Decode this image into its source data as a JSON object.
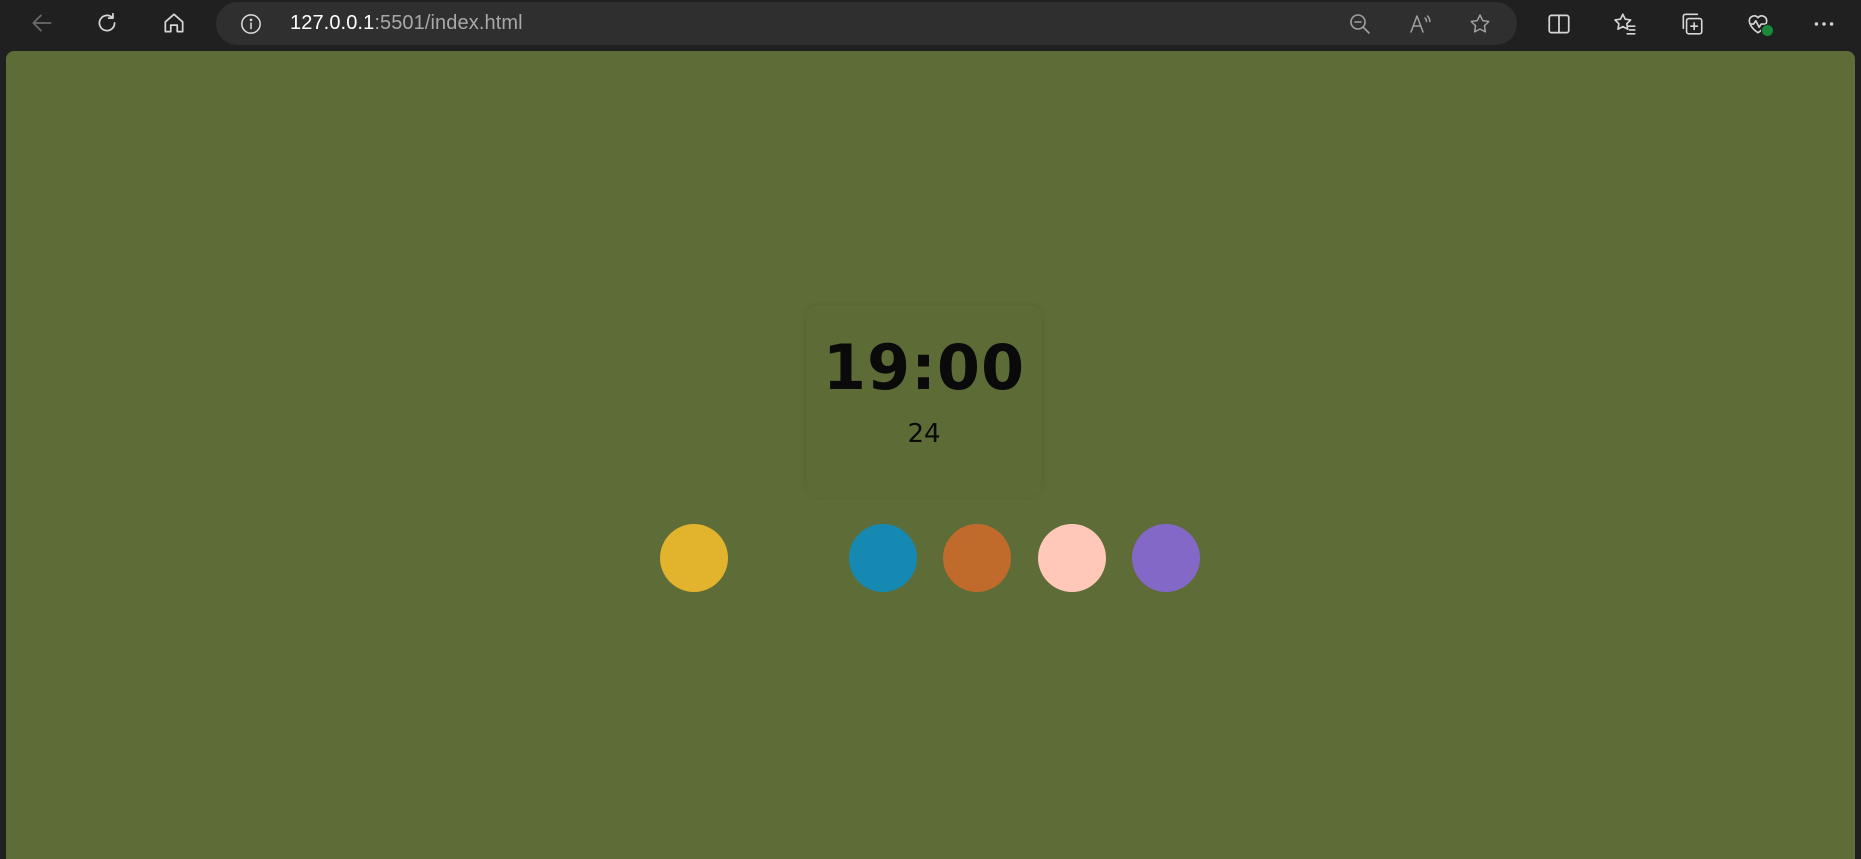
{
  "browser": {
    "url_host": "127.0.0.1",
    "url_rest": ":5501/index.html",
    "icons": [
      "back-arrow-icon",
      "refresh-icon",
      "home-icon",
      "info-icon",
      "zoom-out-icon",
      "read-aloud-icon",
      "favorite-star-icon",
      "split-screen-icon",
      "favorites-icon",
      "collections-icon",
      "browser-essentials-icon",
      "more-options-icon"
    ]
  },
  "clock": {
    "time": "19:00",
    "subtitle": "24"
  },
  "swatches": [
    {
      "color": "#e2b32d"
    },
    {
      "color": "#5e6c37"
    },
    {
      "color": "#1689b3"
    },
    {
      "color": "#c06a2b"
    },
    {
      "color": "#ffc8b8"
    },
    {
      "color": "#8468c8"
    }
  ],
  "colors": {
    "page_background": "#5e6c37",
    "browser_chrome": "#202020"
  }
}
